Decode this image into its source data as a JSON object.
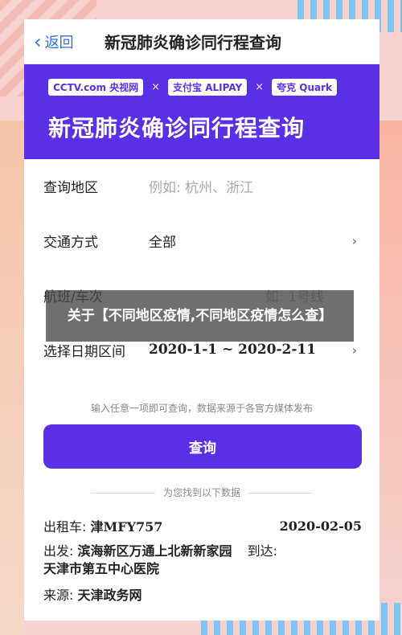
{
  "nav": {
    "back_label": "返回",
    "title": "新冠肺炎确诊同行程查询"
  },
  "banner": {
    "logos": [
      "CCTV.com 央视网",
      "支付宝 ALIPAY",
      "夸克 Quark"
    ],
    "separator": "×",
    "title": "新冠肺炎确诊同行程查询"
  },
  "form": {
    "region_label": "查询地区",
    "region_placeholder": "例如: 杭州、浙江",
    "transport_label": "交通方式",
    "transport_value": "全部",
    "flight_label": "航班/车次",
    "flight_placeholder": "如: 1号线",
    "date_label": "选择日期区间",
    "date_value": "2020-1-1 ~ 2020-2-11",
    "arrow": "›"
  },
  "hint": "输入任意一项即可查询，数据来源于各官方媒体发布",
  "query_button": "查询",
  "found_text": "为您找到以下数据",
  "result": {
    "taxi_label": "出租车:",
    "taxi_plate": "津MFY757",
    "date": "2020-02-05",
    "from_label": "出发:",
    "from_value": "滨海新区万通上北新新家园",
    "to_label": "到达:",
    "to_value": "天津市第五中心医院",
    "source_label": "来源:",
    "source_value": "天津政务网"
  },
  "overlay_title": "关于【不同地区疫情,不同地区疫情怎么查】",
  "colors": {
    "primary": "#5b2fe6",
    "link": "#2f6fe0",
    "background": "#f6d3cf"
  }
}
